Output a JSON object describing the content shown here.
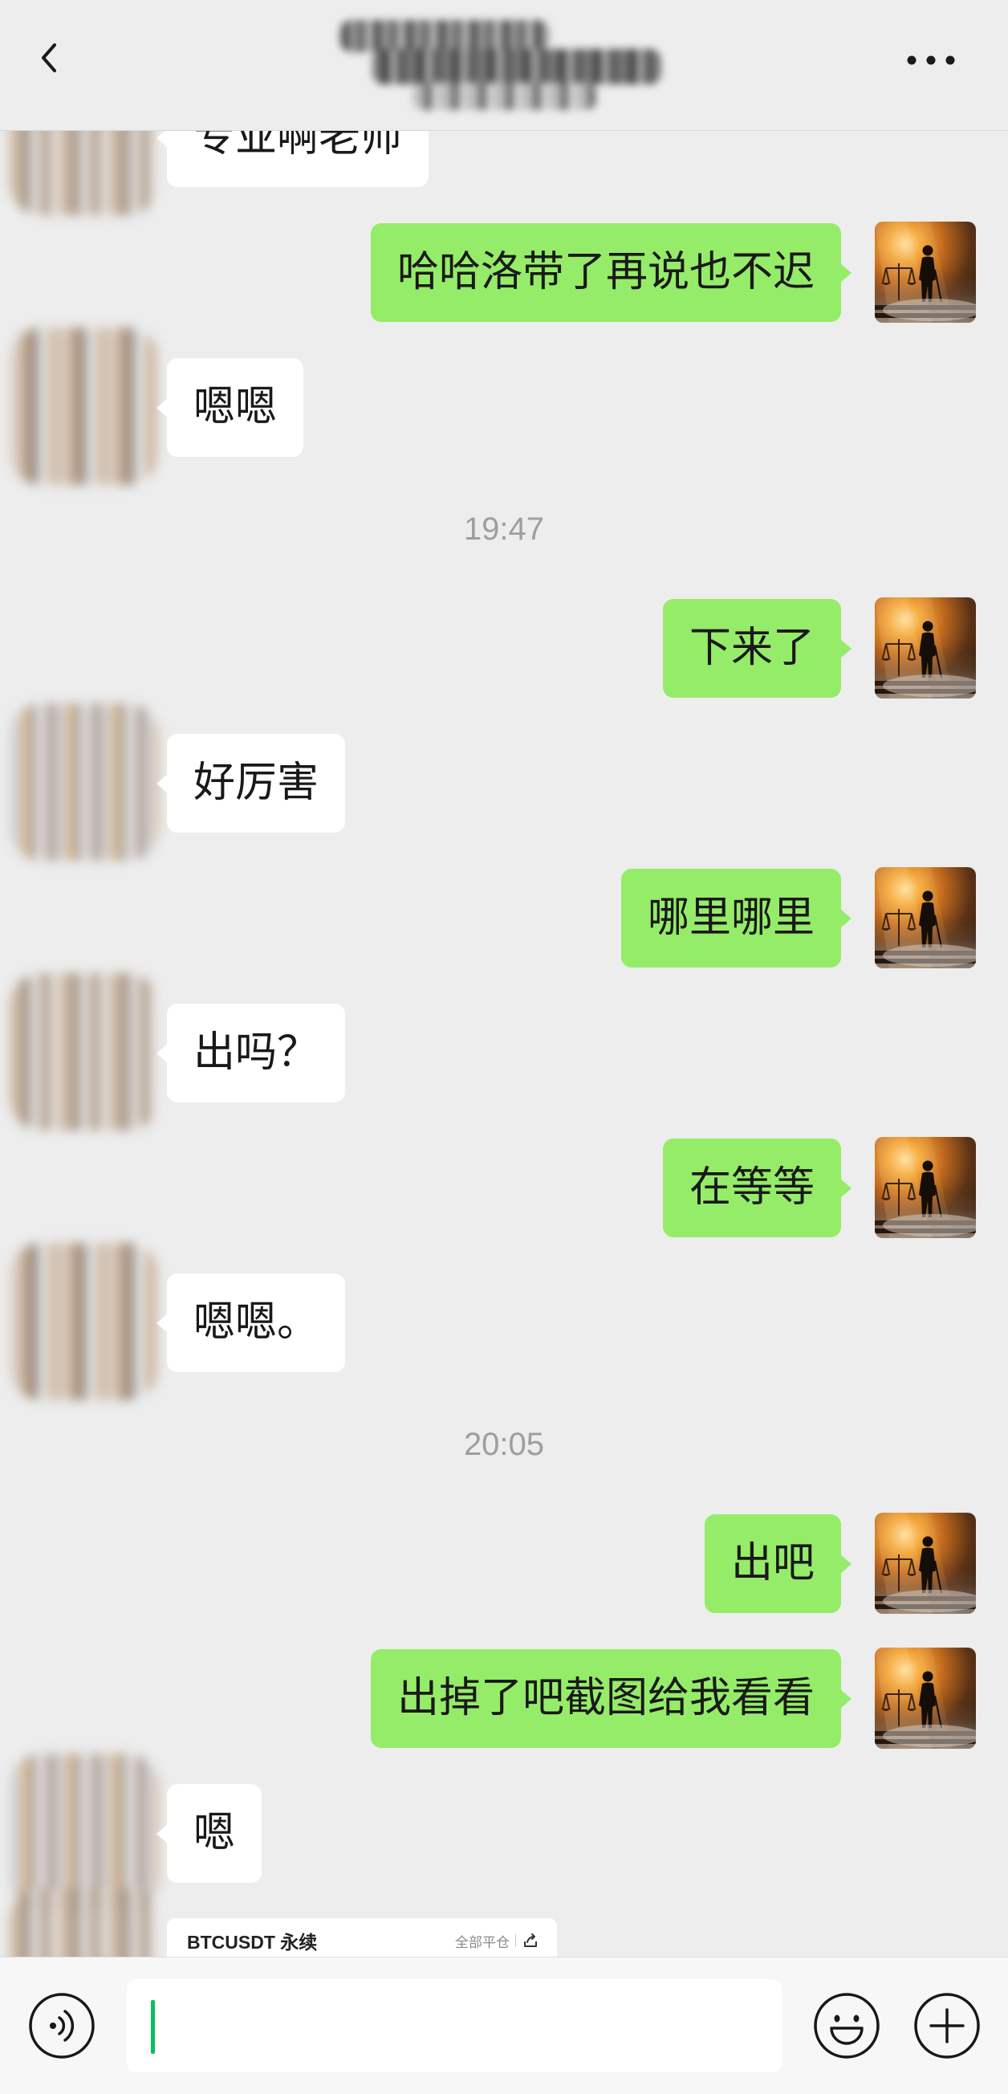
{
  "header": {
    "back_icon": "chevron-left-icon",
    "more_icon": "more-dots-icon"
  },
  "chat": [
    {
      "type": "message",
      "side": "left",
      "text": "专业啊老师"
    },
    {
      "type": "message",
      "side": "right",
      "text": "哈哈洛带了再说也不迟"
    },
    {
      "type": "message",
      "side": "left",
      "text": "嗯嗯"
    },
    {
      "type": "time",
      "text": "19:47"
    },
    {
      "type": "message",
      "side": "right",
      "text": "下来了"
    },
    {
      "type": "message",
      "side": "left",
      "text": "好厉害"
    },
    {
      "type": "message",
      "side": "right",
      "text": "哪里哪里"
    },
    {
      "type": "message",
      "side": "left",
      "text": "出吗？"
    },
    {
      "type": "message",
      "side": "right",
      "text": "在等等"
    },
    {
      "type": "message",
      "side": "left",
      "text": "嗯嗯。"
    },
    {
      "type": "time",
      "text": "20:05"
    },
    {
      "type": "message",
      "side": "right",
      "text": "出吧"
    },
    {
      "type": "message",
      "side": "right",
      "text": "出掉了吧截图给我看看"
    },
    {
      "type": "message",
      "side": "left",
      "text": "嗯"
    },
    {
      "type": "card",
      "side": "left",
      "title": "BTCUSDT 永续",
      "action": "全部平仓",
      "action_icon": "share-icon"
    }
  ],
  "input_bar": {
    "voice_icon": "voice-icon",
    "emoji_icon": "emoji-icon",
    "plus_icon": "plus-icon"
  },
  "colors": {
    "chat_background": "#ededed",
    "bubble_self": "#95ec69",
    "bubble_other": "#ffffff",
    "timestamp_text": "#9e9e9e",
    "cursor": "#07c160",
    "input_bar_background": "#f7f7f7"
  }
}
